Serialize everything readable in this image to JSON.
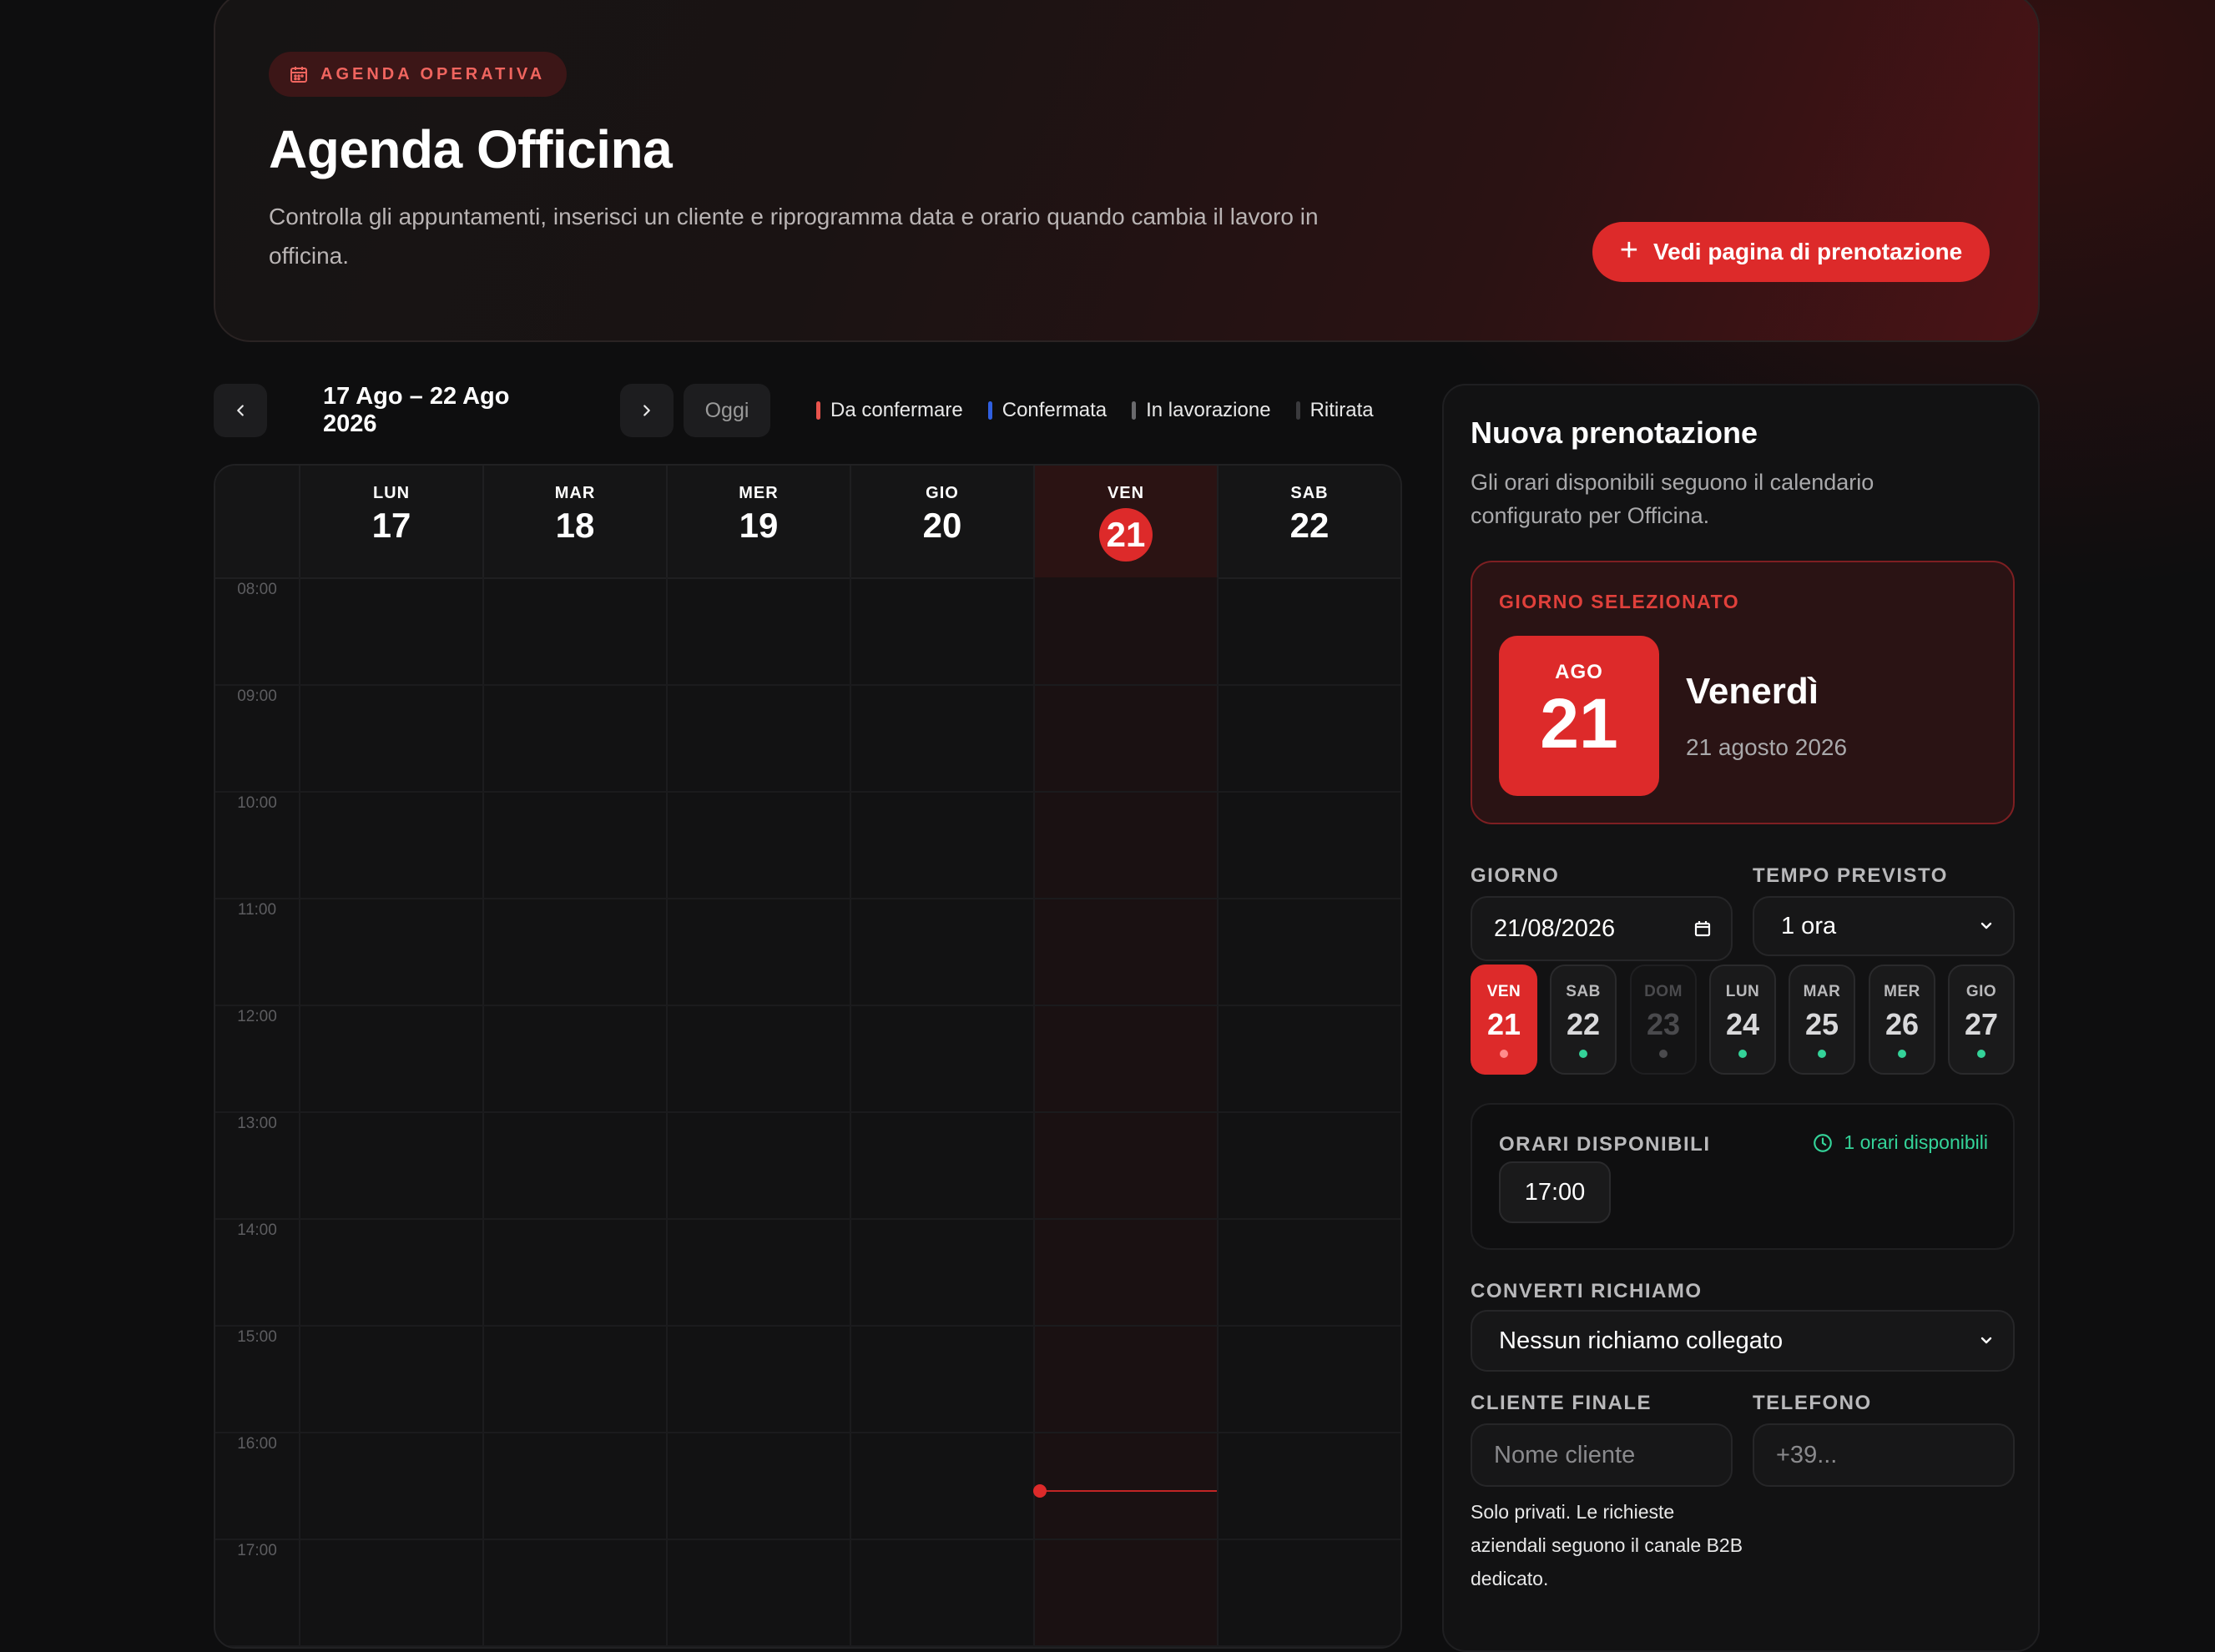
{
  "header": {
    "badge": "AGENDA OPERATIVA",
    "title": "Agenda Officina",
    "description": "Controlla gli appuntamenti, inserisci un cliente e riprogramma data e orario quando cambia il lavoro in officina.",
    "cta_label": "Vedi pagina di prenotazione",
    "cta_icon": "plus-icon"
  },
  "toolbar": {
    "range": "17 Ago – 22 Ago 2026",
    "today_label": "Oggi",
    "legend": [
      {
        "label": "Da confermare",
        "color": "#e8534c"
      },
      {
        "label": "Confermata",
        "color": "#2f5fe0"
      },
      {
        "label": "In lavorazione",
        "color": "#6a6a6d"
      },
      {
        "label": "Ritirata",
        "color": "#3a3a3d"
      }
    ]
  },
  "calendar": {
    "days": [
      {
        "dow": "LUN",
        "num": "17"
      },
      {
        "dow": "MAR",
        "num": "18"
      },
      {
        "dow": "MER",
        "num": "19"
      },
      {
        "dow": "GIO",
        "num": "20"
      },
      {
        "dow": "VEN",
        "num": "21",
        "active": true
      },
      {
        "dow": "SAB",
        "num": "22"
      }
    ],
    "hours": [
      "08:00",
      "09:00",
      "10:00",
      "11:00",
      "12:00",
      "13:00",
      "14:00",
      "15:00",
      "16:00",
      "17:00"
    ],
    "current_time_indicator": {
      "day": "21",
      "hour": 16.55
    }
  },
  "panel": {
    "title": "Nuova prenotazione",
    "subtitle": "Gli orari disponibili seguono il calendario configurato per Officina.",
    "selected": {
      "label": "GIORNO SELEZIONATO",
      "month": "AGO",
      "day": "21",
      "weekday": "Venerdì",
      "full_date": "21 agosto 2026"
    },
    "giorno_label": "GIORNO",
    "giorno_value": "21/08/2026",
    "tempo_label": "TEMPO PREVISTO",
    "tempo_value": "1 ora",
    "days_strip": [
      {
        "dow": "VEN",
        "num": "21",
        "state": "active"
      },
      {
        "dow": "SAB",
        "num": "22",
        "state": "available"
      },
      {
        "dow": "DOM",
        "num": "23",
        "state": "closed"
      },
      {
        "dow": "LUN",
        "num": "24",
        "state": "available"
      },
      {
        "dow": "MAR",
        "num": "25",
        "state": "available"
      },
      {
        "dow": "MER",
        "num": "26",
        "state": "available"
      },
      {
        "dow": "GIO",
        "num": "27",
        "state": "available"
      }
    ],
    "slots_label": "ORARI DISPONIBILI",
    "slots_count": "1 orari disponibili",
    "slots": [
      "17:00"
    ],
    "richiamo_label": "CONVERTI RICHIAMO",
    "richiamo_value": "Nessun richiamo collegato",
    "cliente_label": "CLIENTE FINALE",
    "cliente_placeholder": "Nome cliente",
    "telefono_label": "TELEFONO",
    "telefono_placeholder": "+39...",
    "note": "Solo privati. Le richieste aziendali seguono il canale B2B dedicato."
  }
}
